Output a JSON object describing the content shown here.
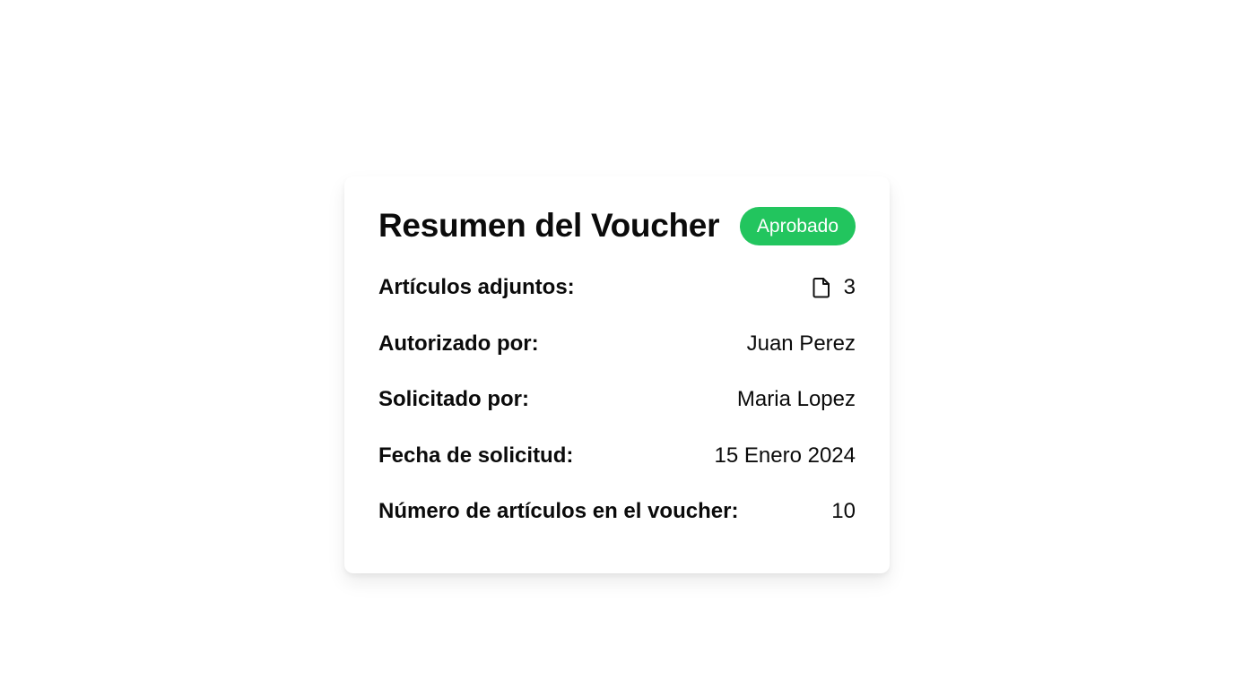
{
  "voucher": {
    "title": "Resumen del Voucher",
    "status": "Aprobado",
    "status_color": "#22c55e",
    "attachments_icon": "file-icon",
    "rows": [
      {
        "label": "Artículos adjuntos:",
        "value": "3"
      },
      {
        "label": "Autorizado por:",
        "value": "Juan Perez"
      },
      {
        "label": "Solicitado por:",
        "value": "Maria Lopez"
      },
      {
        "label": "Fecha de solicitud:",
        "value": "15 Enero 2024"
      },
      {
        "label": "Número de artículos en el voucher:",
        "value": "10"
      }
    ]
  }
}
